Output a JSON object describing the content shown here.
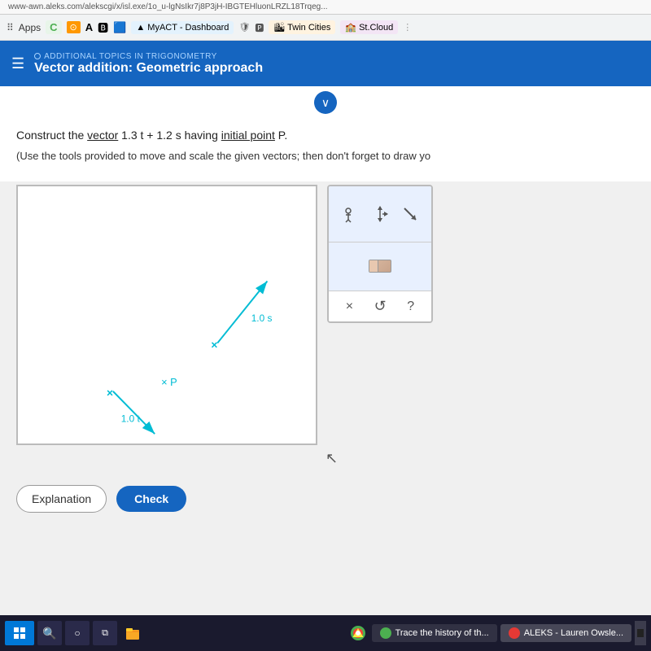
{
  "browser": {
    "address": "www-awn.aleks.com/alekscgi/x/isl.exe/1o_u-lgNsIkr7j8P3jH-IBGTEHluonLRZL18Trqeg..."
  },
  "bookmarks": {
    "apps_label": "Apps",
    "items": [
      {
        "label": "C",
        "color": "#4CAF50"
      },
      {
        "label": "A",
        "color": "#333"
      },
      {
        "label": "MyACT - Dashboard",
        "color": "#333"
      },
      {
        "label": "Twin Cities",
        "color": "#333"
      },
      {
        "label": "St.Cloud",
        "color": "#333"
      }
    ]
  },
  "header": {
    "subtitle": "ADDITIONAL TOPICS IN TRIGONOMETRY",
    "title": "Vector addition: Geometric approach"
  },
  "problem": {
    "text1_pre": "Construct the ",
    "text1_vector": "vector",
    "text1_mid": " 1.3 t + 1.2 s having ",
    "text1_initial": "initial point",
    "text1_post": " P.",
    "hint": "(Use the tools provided to move and scale the given vectors; then don't forget to draw yo",
    "vector_s_label": "1.0 s",
    "vector_t_label": "1.0 t",
    "point_p_label": "P"
  },
  "tools": {
    "cross_label": "×",
    "undo_label": "↺",
    "help_label": "?"
  },
  "buttons": {
    "explanation_label": "Explanation",
    "check_label": "Check"
  },
  "taskbar": {
    "search_label": "🔍",
    "app1_label": "Trace the history of th...",
    "app2_label": "ALEKS - Lauren Owsle..."
  },
  "colors": {
    "accent_blue": "#1565c0",
    "vector_color": "#00bcd4",
    "label_color": "#00bcd4"
  }
}
